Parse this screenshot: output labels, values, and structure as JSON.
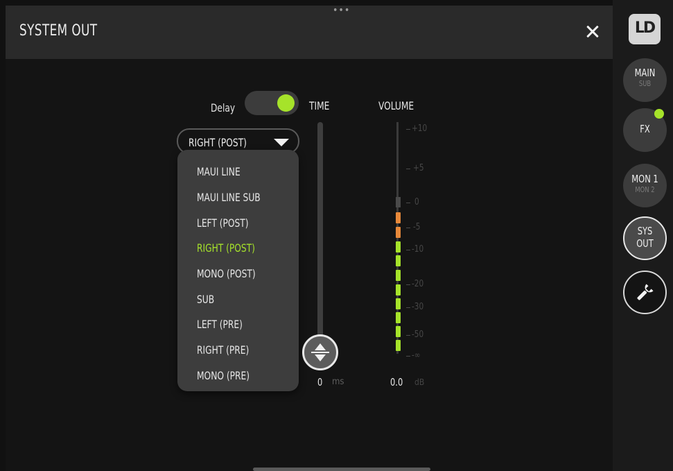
{
  "panel": {
    "title": "SYSTEM OUT",
    "more_glyph": "•••",
    "close_icon": "close-x-icon"
  },
  "delay": {
    "label": "Delay",
    "enabled": true,
    "accent": "#a6e32a"
  },
  "columns": {
    "time_label": "TIME",
    "volume_label": "VOLUME"
  },
  "output_select": {
    "value": "RIGHT (POST)",
    "icon": "chevron-down-icon",
    "options": [
      {
        "label": "MAUI LINE",
        "selected": false
      },
      {
        "label": "MAUI LINE SUB",
        "selected": false
      },
      {
        "label": "LEFT (POST)",
        "selected": false
      },
      {
        "label": "RIGHT (POST)",
        "selected": true
      },
      {
        "label": "MONO (POST)",
        "selected": false
      },
      {
        "label": "SUB",
        "selected": false
      },
      {
        "label": "LEFT (PRE)",
        "selected": false
      },
      {
        "label": "RIGHT (PRE)",
        "selected": false
      },
      {
        "label": "MONO (PRE)",
        "selected": false
      }
    ]
  },
  "time": {
    "value": "0",
    "unit": "ms"
  },
  "volume": {
    "value": "0.0",
    "unit": "dB",
    "scale_labels": [
      "+10",
      "+5",
      "0",
      "-5",
      "-10",
      "-20",
      "-30",
      "-50",
      "-∞"
    ],
    "meter_colors": {
      "hot": "#e8893a",
      "normal": "#a6e32a"
    }
  },
  "rail": {
    "logo": "LD",
    "main": {
      "label": "MAIN",
      "sub": "SUB"
    },
    "fx": {
      "label": "FX",
      "indicator_color": "#a6e32a"
    },
    "mon": {
      "label": "MON 1",
      "sub": "MON 2"
    },
    "sys": {
      "line1": "SYS",
      "line2": "OUT"
    },
    "settings_icon": "wrench-icon"
  }
}
